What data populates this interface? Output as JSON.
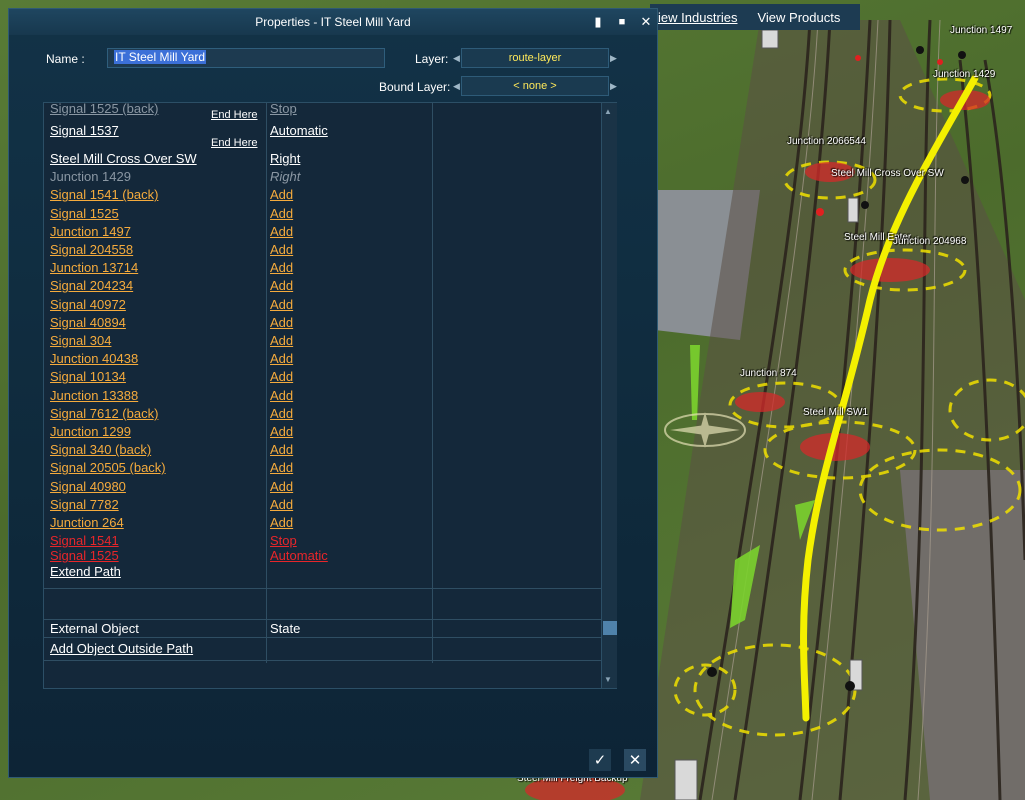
{
  "window": {
    "title": "Properties - IT Steel Mill Yard",
    "name_label": "Name :",
    "name_value": "IT Steel Mill Yard",
    "layer_label": "Layer:",
    "layer_value": "route-layer",
    "bound_layer_label": "Bound Layer:",
    "bound_layer_value": "< none >"
  },
  "topbar": {
    "view_industries": "iew Industries",
    "view_products": "View Products"
  },
  "path_rows": [
    {
      "name": "Signal 1525 (back)",
      "state": "Stop",
      "style": "gray-cut"
    },
    {
      "name": "Signal 1537",
      "state": "Automatic",
      "style": "white",
      "end_here": "End Here"
    },
    {
      "name": "Steel Mill Cross Over SW",
      "state": "Right",
      "style": "white",
      "end_here": "End Here"
    },
    {
      "name": "Junction 1429",
      "state": "Right",
      "style": "gray"
    },
    {
      "name": "Signal 1541 (back)",
      "state": "Add",
      "style": "orange"
    },
    {
      "name": "Signal 1525",
      "state": "Add",
      "style": "orange"
    },
    {
      "name": "Junction 1497",
      "state": "Add",
      "style": "orange"
    },
    {
      "name": "Signal 204558",
      "state": "Add",
      "style": "orange"
    },
    {
      "name": "Junction 13714",
      "state": "Add",
      "style": "orange"
    },
    {
      "name": "Signal 204234",
      "state": "Add",
      "style": "orange"
    },
    {
      "name": "Signal 40972",
      "state": "Add",
      "style": "orange"
    },
    {
      "name": "Signal 40894",
      "state": "Add",
      "style": "orange"
    },
    {
      "name": "Signal 304",
      "state": "Add",
      "style": "orange"
    },
    {
      "name": "Junction 40438",
      "state": "Add",
      "style": "orange"
    },
    {
      "name": "Signal 10134",
      "state": "Add",
      "style": "orange"
    },
    {
      "name": "Junction 13388",
      "state": "Add",
      "style": "orange"
    },
    {
      "name": "Signal 7612 (back)",
      "state": "Add",
      "style": "orange"
    },
    {
      "name": "Junction 1299",
      "state": "Add",
      "style": "orange"
    },
    {
      "name": "Signal 340 (back)",
      "state": "Add",
      "style": "orange"
    },
    {
      "name": "Signal 20505 (back)",
      "state": "Add",
      "style": "orange"
    },
    {
      "name": "Signal 40980",
      "state": "Add",
      "style": "orange"
    },
    {
      "name": "Signal 7782",
      "state": "Add",
      "style": "orange"
    },
    {
      "name": "Junction 264",
      "state": "Add",
      "style": "orange"
    },
    {
      "name": "Signal 1541",
      "state": "Stop",
      "style": "red"
    },
    {
      "name": "Signal 1525",
      "state": "Automatic",
      "style": "red"
    }
  ],
  "extend_path": "Extend Path",
  "external": {
    "header_object": "External Object",
    "header_state": "State",
    "add_object": "Add Object Outside Path"
  },
  "scene_labels": [
    "Junction 1497",
    "Junction 1429",
    "Junction 2066544",
    "Steel Mill Cross Over SW",
    "Steel Mill Enter",
    "Junction 204968",
    "Junction 874",
    "Steel Mill SW1",
    "Steel Mill Freight Backup"
  ],
  "colors": {
    "orange": "#f5ab3d",
    "red": "#e8262a",
    "gray": "#8a97a3",
    "path_yellow": "#f4f000",
    "window_bg": "#0f2a3c"
  }
}
